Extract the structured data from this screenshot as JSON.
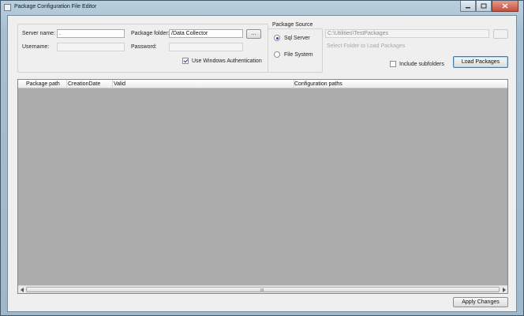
{
  "window": {
    "title": "Package Configuration File Editor"
  },
  "connection": {
    "server_name_label": "Server name:",
    "server_name_value": ".",
    "username_label": "Username:",
    "username_value": "",
    "package_folder_label": "Package folder:",
    "package_folder_value": "/Data Collector",
    "browse_label": "...",
    "password_label": "Password:",
    "password_value": "",
    "windows_auth_label": "Use Windows Authentication",
    "windows_auth_checked": true
  },
  "package_source": {
    "title": "Package Source",
    "options": [
      {
        "label": "Sql Server",
        "selected": true
      },
      {
        "label": "File System",
        "selected": false
      }
    ]
  },
  "file_system": {
    "path_value": "C:\\Utilities\\TestPackages",
    "browse_label": "",
    "hint_label": "Select Folder to Load Packages",
    "include_subfolders_label": "Include subfolders",
    "include_subfolders_checked": false,
    "load_button_label": "Load Packages"
  },
  "grid": {
    "columns": [
      "Package path",
      "CreationDate",
      "Valid",
      "Configuration paths"
    ],
    "rows": [],
    "scroll_grip": "III"
  },
  "footer": {
    "apply_label": "Apply Changes"
  }
}
